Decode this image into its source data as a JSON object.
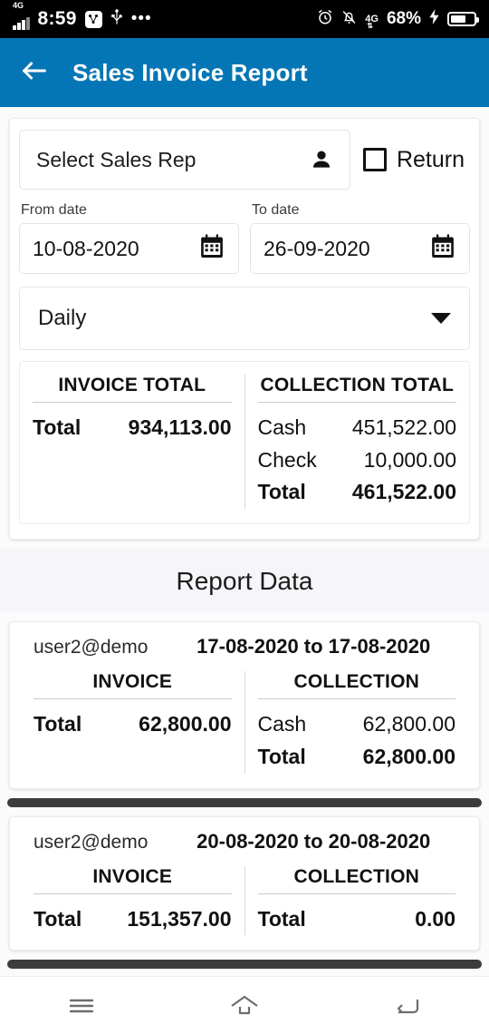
{
  "statusbar": {
    "network_label": "4G",
    "time": "8:59",
    "battery_percent": "68%",
    "icons": [
      "signal-bars-icon",
      "nfc-icon",
      "usb-icon",
      "more-dots-icon",
      "alarm-icon",
      "bell-muted-icon",
      "data-transfer-4g-icon",
      "charging-bolt-icon",
      "battery-icon"
    ]
  },
  "appbar": {
    "title": "Sales Invoice Report",
    "back_icon": "back-arrow-icon"
  },
  "filters": {
    "sales_rep_placeholder": "Select Sales Rep",
    "person_icon": "person-icon",
    "return_label": "Return",
    "return_checked": false,
    "from_date_label": "From date",
    "from_date_value": "10-08-2020",
    "to_date_label": "To date",
    "to_date_value": "26-09-2020",
    "calendar_icon": "calendar-icon",
    "period_value": "Daily",
    "period_caret": "chevron-down-icon"
  },
  "summary": {
    "invoice_header": "INVOICE TOTAL",
    "collection_header": "COLLECTION TOTAL",
    "invoice_rows": [
      {
        "label": "Total",
        "value": "934,113.00",
        "bold": true
      }
    ],
    "collection_rows": [
      {
        "label": "Cash",
        "value": "451,522.00",
        "bold": false
      },
      {
        "label": "Check",
        "value": "10,000.00",
        "bold": false
      },
      {
        "label": "Total",
        "value": "461,522.00",
        "bold": true
      }
    ]
  },
  "report": {
    "section_title": "Report Data",
    "cards": [
      {
        "user": "user2@demo",
        "range": "17-08-2020 to 17-08-2020",
        "invoice_header": "INVOICE",
        "collection_header": "COLLECTION",
        "invoice_rows": [
          {
            "label": "Total",
            "value": "62,800.00",
            "bold": true
          }
        ],
        "collection_rows": [
          {
            "label": "Cash",
            "value": "62,800.00",
            "bold": false
          },
          {
            "label": "Total",
            "value": "62,800.00",
            "bold": true
          }
        ]
      },
      {
        "user": "user2@demo",
        "range": "20-08-2020 to 20-08-2020",
        "invoice_header": "INVOICE",
        "collection_header": "COLLECTION",
        "invoice_rows": [
          {
            "label": "Total",
            "value": "151,357.00",
            "bold": true
          }
        ],
        "collection_rows": [
          {
            "label": "Total",
            "value": "0.00",
            "bold": true
          }
        ]
      }
    ]
  },
  "navbar": {
    "recents_icon": "recents-menu-icon",
    "home_icon": "home-icon",
    "back_icon": "back-nav-icon"
  },
  "colors": {
    "accent": "#0576b5",
    "page_bg": "#fbfbfb",
    "band_bg": "#f6f6fa",
    "scrollbar": "#3c3c3c"
  }
}
